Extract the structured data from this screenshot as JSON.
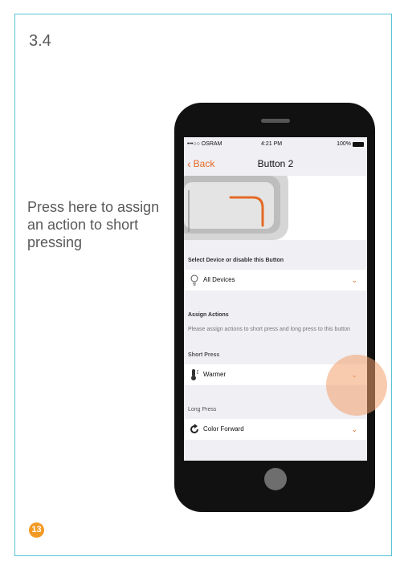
{
  "section_number": "3.4",
  "hint_text": "Press here to assign an action to short pressing",
  "page_badge": "13",
  "status": {
    "carrier": "•••○○ OSRAM",
    "time": "4:21 PM",
    "battery": "100%"
  },
  "nav": {
    "back_label": "Back",
    "title": "Button 2"
  },
  "device_section": {
    "title": "Select Device or disable this Button",
    "selected": "All Devices"
  },
  "actions": {
    "title": "Assign Actions",
    "description": "Please assign actions to short press and long press to this button",
    "short_press": {
      "title": "Short Press",
      "value": "Warmer"
    },
    "long_press": {
      "title": "Long Press",
      "value": "Color Forward"
    }
  },
  "colors": {
    "accent": "#e46a25",
    "frame": "#57c3d4",
    "badge": "#f39a24",
    "tap_highlight": "#f39e6c"
  }
}
